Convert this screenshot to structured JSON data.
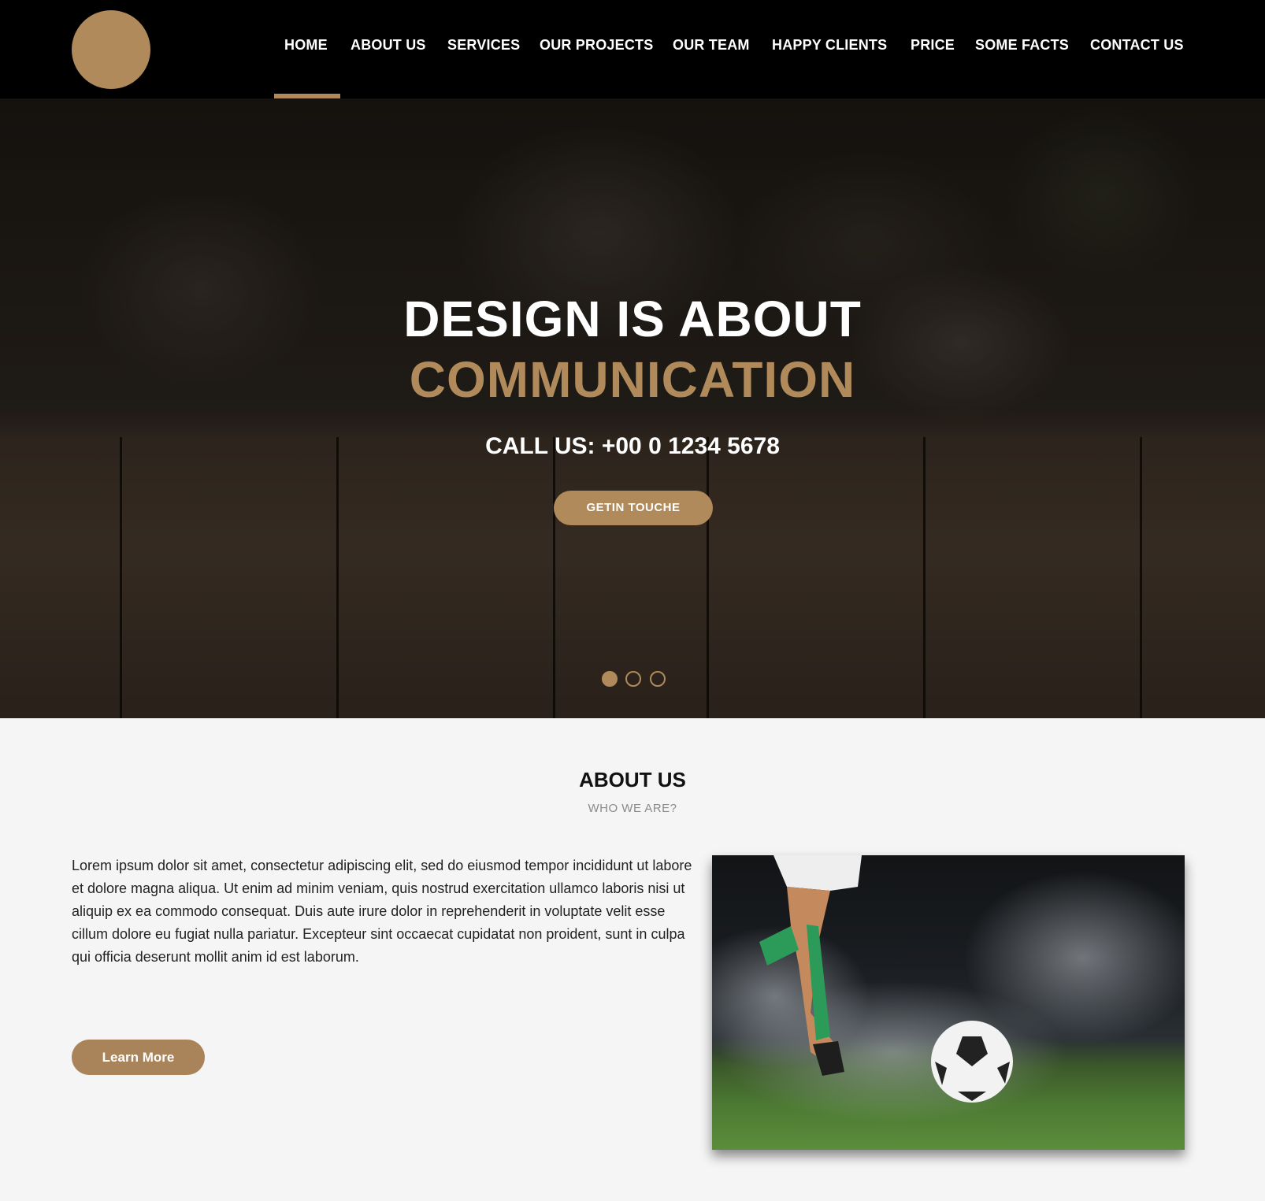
{
  "nav": {
    "items": [
      {
        "label": "HOME"
      },
      {
        "label": "ABOUT US"
      },
      {
        "label": "SERVICES"
      },
      {
        "label": "OUR PROJECTS"
      },
      {
        "label": "OUR TEAM"
      },
      {
        "label": "HAPPY CLIENTS"
      },
      {
        "label": "PRICE"
      },
      {
        "label": "SOME FACTS"
      },
      {
        "label": "CONTACT US"
      }
    ],
    "active": "HOME"
  },
  "hero": {
    "title_line1": "DESIGN IS ABOUT",
    "title_line2": "COMMUNICATION",
    "call": "CALL US: +00 0 1234 5678",
    "button": "GETIN TOUCHE",
    "slides": 3,
    "active_slide": 1
  },
  "about": {
    "title": "ABOUT US",
    "subtitle": "WHO WE ARE?",
    "body": "Lorem ipsum dolor sit amet, consectetur adipiscing elit, sed do eiusmod tempor incididunt ut labore et dolore magna aliqua. Ut enim ad minim veniam, quis nostrud exercitation ullamco laboris nisi ut aliquip ex ea commodo consequat. Duis aute irure dolor in reprehenderit in voluptate velit esse cillum dolore eu fugiat nulla pariatur. Excepteur sint occaecat cupidatat non proident, sunt in culpa qui officia deserunt mollit anim id est laborum.",
    "button": "Learn More"
  },
  "colors": {
    "accent": "#b08a5a",
    "header_bg": "#000000",
    "page_bg": "#f5f5f5"
  }
}
